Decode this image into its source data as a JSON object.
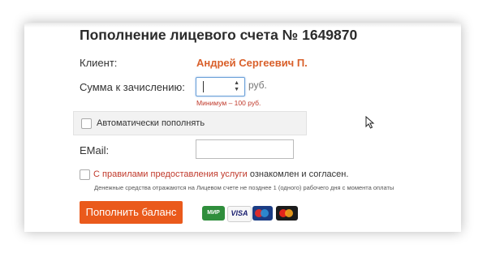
{
  "header": {
    "title": "Пополнение лицевого счета № 1649870"
  },
  "form": {
    "client_label": "Клиент:",
    "client_name": "Андрей Сергеевич П.",
    "amount_label": "Сумма к зачислению:",
    "amount_value": "",
    "currency": "руб.",
    "min_hint": "Минимум – 100 руб.",
    "auto_refill_label": "Автоматически пополнять",
    "auto_refill_checked": false,
    "email_label": "EMail:",
    "email_value": "",
    "agree_prefix": "С",
    "agree_link": "правилами предоставления услуги",
    "agree_suffix": "ознакомлен и согласен.",
    "agree_checked": false,
    "note": "Денежные средства отражаются на Лицевом счете не позднее 1 (одного) рабочего дня с момента оплаты",
    "submit_label": "Пополнить баланс"
  },
  "payment_logos": {
    "mir": "МИР",
    "visa": "VISA",
    "maestro_icon": "maestro-logo-icon",
    "mastercard_icon": "mastercard-logo-icon"
  },
  "colors": {
    "accent": "#ea5a1c",
    "client_name": "#d9602b",
    "hint": "#c0392b"
  }
}
